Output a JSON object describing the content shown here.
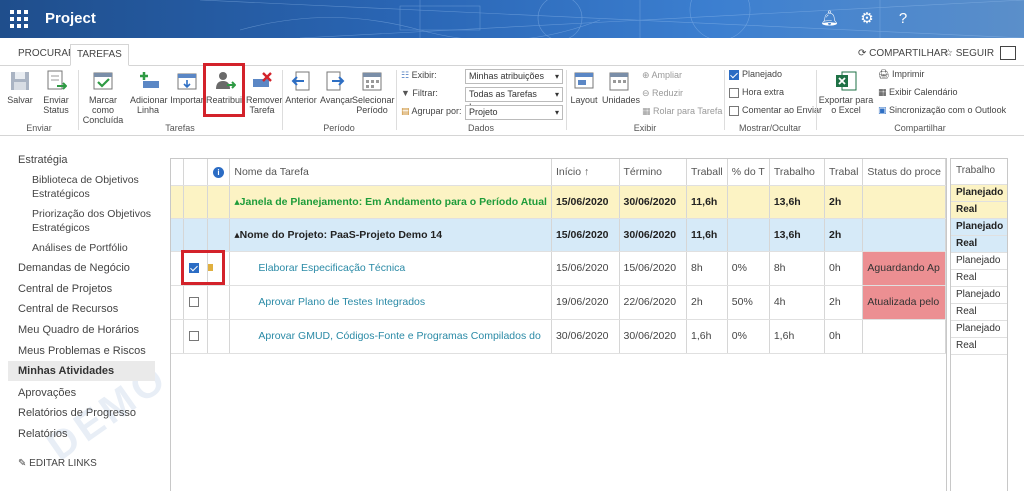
{
  "app": {
    "title": "Project",
    "accent": "#2a66b5"
  },
  "ribbon_tabs": [
    {
      "label": "PROCURAR"
    },
    {
      "label": "TAREFAS",
      "active": true
    }
  ],
  "top_actions": {
    "share": "COMPARTILHAR",
    "follow": "SEGUIR"
  },
  "ribbon": {
    "save": "Salvar",
    "send_status": "Enviar Status",
    "mark_complete": "Marcar como Concluída",
    "add_line": "Adicionar Linha",
    "import": "Importar",
    "reassign": "Reatribuir",
    "remove_task": "Remover Tarefa",
    "previous": "Anterior",
    "advance": "Avançar",
    "select_period": "Selecionar Período",
    "show_label": "Exibir:",
    "show_value": "Minhas atribuições",
    "filter_label": "Filtrar:",
    "filter_value": "Todas as Tarefas Incom",
    "group_label": "Agrupar por:",
    "group_value": "Projeto",
    "layout": "Layout",
    "units": "Unidades",
    "zoom_in": "Ampliar",
    "zoom_out": "Reduzir",
    "scroll_to_task": "Rolar para Tarefa",
    "planned": "Planejado",
    "overtime": "Hora extra",
    "comment_on_send": "Comentar ao Enviar",
    "export_excel": "Exportar para o Excel",
    "print": "Imprimir",
    "show_calendar": "Exibir Calendário",
    "sync_outlook": "Sincronização com o Outlook",
    "groups": {
      "enviar": "Enviar",
      "tarefas": "Tarefas",
      "periodo": "Período",
      "dados": "Dados",
      "exibir": "Exibir",
      "mostrar": "Mostrar/Ocultar",
      "compartilhar": "Compartilhar"
    }
  },
  "sidebar": {
    "items": [
      {
        "label": "Estratégia"
      },
      {
        "label": "Biblioteca de Objetivos Estratégicos",
        "sub": true
      },
      {
        "label": "Priorização dos Objetivos Estratégicos",
        "sub": true
      },
      {
        "label": "Análises de Portfólio",
        "sub": true
      },
      {
        "label": "Demandas de Negócio"
      },
      {
        "label": "Central de Projetos"
      },
      {
        "label": "Central de Recursos"
      },
      {
        "label": "Meu Quadro de Horários"
      },
      {
        "label": "Meus Problemas e Riscos"
      },
      {
        "label": "Minhas Atividades",
        "active": true
      },
      {
        "label": "Aprovações"
      },
      {
        "label": "Relatórios de Progresso"
      },
      {
        "label": "Relatórios"
      }
    ],
    "edit_links": "EDITAR LINKS"
  },
  "grid": {
    "headers": [
      "Nome da Tarefa",
      "Início ↑",
      "Término",
      "Traball",
      "% do T",
      "Trabalho",
      "Trabal",
      "Status do proce"
    ],
    "rows": [
      {
        "type": "summary1",
        "name": "Janela de Planejamento: Em Andamento para o Período Atual",
        "start": "15/06/2020",
        "end": "30/06/2020",
        "w1": "11,6h",
        "pct": "",
        "work": "13,6h",
        "w2": "2h",
        "status": ""
      },
      {
        "type": "summary2",
        "name": "Nome do Projeto: PaaS-Projeto Demo 14",
        "start": "15/06/2020",
        "end": "30/06/2020",
        "w1": "11,6h",
        "pct": "",
        "work": "13,6h",
        "w2": "2h",
        "status": ""
      },
      {
        "type": "task",
        "checked": true,
        "name": "Elaborar Especificação Técnica",
        "start": "15/06/2020",
        "end": "15/06/2020",
        "w1": "8h",
        "pct": "0%",
        "work": "8h",
        "w2": "0h",
        "status": "Aguardando Ap"
      },
      {
        "type": "task",
        "checked": false,
        "name": "Aprovar Plano de Testes Integrados",
        "start": "19/06/2020",
        "end": "22/06/2020",
        "w1": "2h",
        "pct": "50%",
        "work": "4h",
        "w2": "2h",
        "status": "Atualizada pelo"
      },
      {
        "type": "task",
        "checked": false,
        "name": "Aprovar GMUD, Códigos-Fonte e Programas Compilados do",
        "start": "30/06/2020",
        "end": "30/06/2020",
        "w1": "1,6h",
        "pct": "0%",
        "work": "1,6h",
        "w2": "0h",
        "status": ""
      }
    ]
  },
  "timephased": {
    "header": "Trabalho",
    "rows": [
      "Planejado",
      "Real",
      "Planejado",
      "Real",
      "Planejado",
      "Real",
      "Planejado",
      "Real",
      "Planejado",
      "Real"
    ]
  }
}
